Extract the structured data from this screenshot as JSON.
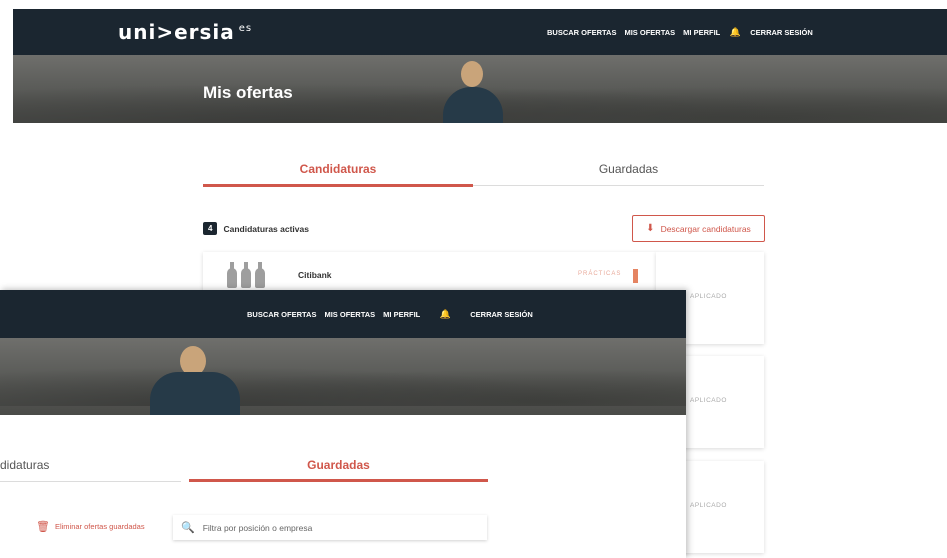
{
  "brand": {
    "logo": "uni>ersia",
    "country": "es"
  },
  "nav": {
    "buscar": "BUSCAR OFERTAS",
    "mis_ofertas": "MIS OFERTAS",
    "mi_perfil": "MI PERFIL",
    "cerrar": "CERRAR SESIÓN"
  },
  "hero": {
    "title": "Mis ofertas"
  },
  "tabs": {
    "candidaturas": "Candidaturas",
    "guardadas": "Guardadas",
    "candidaturas_partial": "didaturas"
  },
  "applications": {
    "count": "4",
    "count_label": "Candidaturas activas",
    "download_label": "Descargar candidaturas",
    "cards": [
      {
        "company": "Citibank",
        "tag": "PRÁCTICAS",
        "status": "APLICADO"
      },
      {
        "status": "APLICADO"
      },
      {
        "status": "APLICADO"
      }
    ]
  },
  "saved": {
    "delete_label": "Eliminar ofertas guardadas",
    "search_placeholder": "Filtra por posición o empresa"
  },
  "colors": {
    "navbar": "#1b2630",
    "accent": "#d0574b"
  }
}
